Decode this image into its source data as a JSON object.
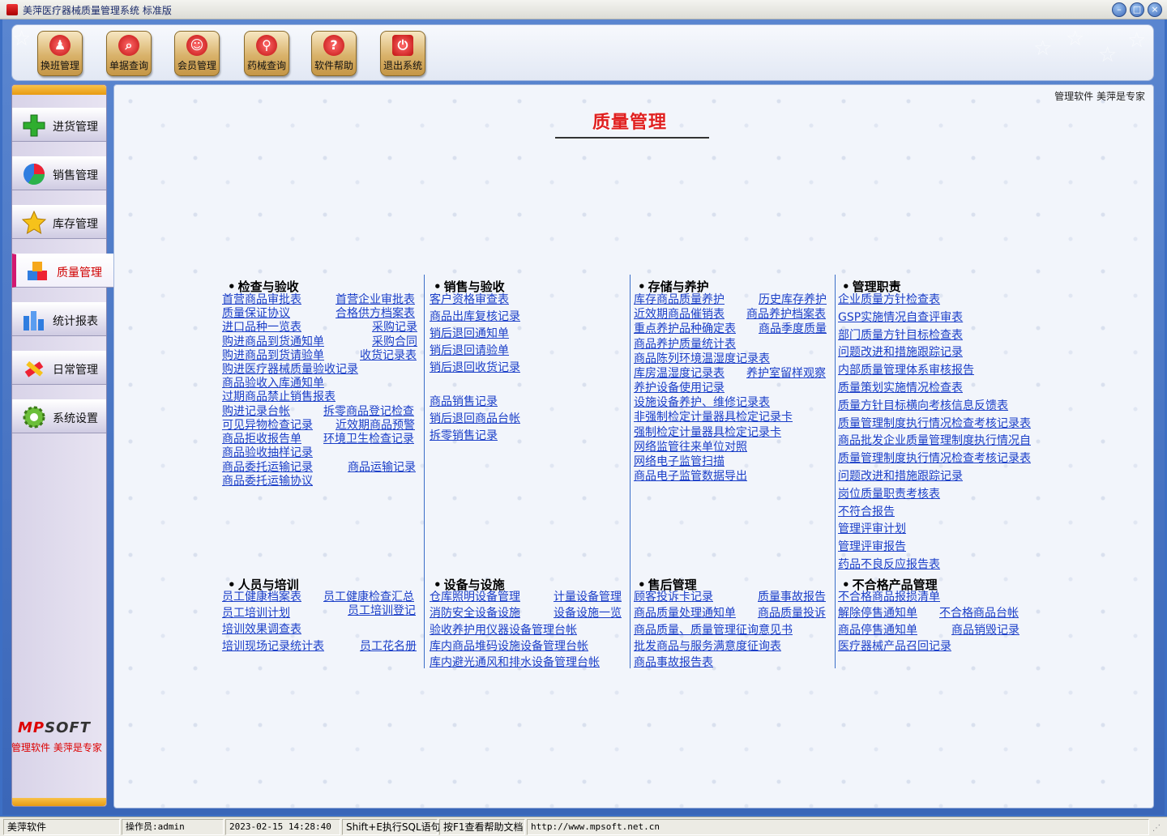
{
  "window": {
    "title": "美萍医疗器械质量管理系统 标准版",
    "minimize": "–",
    "maximize": "□",
    "close": "×"
  },
  "toolbar": [
    {
      "label": "换班管理",
      "icon": "users-icon"
    },
    {
      "label": "单据查询",
      "icon": "search-document-icon"
    },
    {
      "label": "会员管理",
      "icon": "member-icon"
    },
    {
      "label": "药械查询",
      "icon": "search-icon"
    },
    {
      "label": "软件帮助",
      "icon": "help-icon"
    },
    {
      "label": "退出系统",
      "icon": "power-icon"
    }
  ],
  "sidebar": {
    "items": [
      {
        "label": "进货管理",
        "icon": "plus-icon"
      },
      {
        "label": "销售管理",
        "icon": "pie-icon"
      },
      {
        "label": "库存管理",
        "icon": "star-icon"
      },
      {
        "label": "质量管理",
        "icon": "cubes-icon",
        "active": true
      },
      {
        "label": "统计报表",
        "icon": "bar-chart-icon"
      },
      {
        "label": "日常管理",
        "icon": "tools-icon"
      },
      {
        "label": "系统设置",
        "icon": "gear-icon"
      }
    ],
    "logo_brand": "MP",
    "logo_rest": "SOFT",
    "slogan": "管理软件 美萍是专家"
  },
  "main": {
    "corner_text": "管理软件  美萍是专家",
    "title": "质量管理",
    "sections": {
      "inspect": {
        "head": "检查与验收",
        "links": [
          "首营商品审批表",
          "首营企业审批表",
          "质量保证协议",
          "合格供方档案表",
          "进口品种一览表",
          "采购记录",
          "购进商品到货通知单",
          "采购合同",
          "购进商品到货请验单",
          "收货记录表",
          "购进医疗器械质量验收记录",
          "商品验收入库通知单",
          "过期商品禁止销售报表",
          "购进记录台帐",
          "拆零商品登记检查",
          "可见异物检查记录",
          "近效期商品预警",
          "商品拒收报告单",
          "环境卫生检查记录",
          "商品验收抽样记录",
          "商品委托运输记录",
          "商品运输记录",
          "商品委托运输协议"
        ]
      },
      "sales": {
        "head": "销售与验收",
        "links": [
          "客户资格审查表",
          "商品出库复核记录",
          "销后退回通知单",
          "销后退回请验单",
          "销后退回收货记录",
          "商品销售记录",
          "销后退回商品台帐",
          "拆零销售记录"
        ]
      },
      "storage": {
        "head": "存储与养护",
        "links": [
          "库存商品质量养护",
          "历史库存养护",
          "近效期商品催销表",
          "商品养护档案表",
          "重点养护品种确定表",
          "商品季度质量",
          "商品养护质量统计表",
          "商品陈列环境温湿度记录表",
          "库房温湿度记录表",
          "养护室留样观察",
          "养护设备使用记录",
          "设施设备养护、维修记录表",
          "非强制检定计量器具检定记录卡",
          "强制检定计量器具检定记录卡",
          "网络监管往来单位对照",
          "网络电子监管扫描",
          "商品电子监管数据导出"
        ]
      },
      "mgmt": {
        "head": "管理职责",
        "links": [
          "企业质量方针检查表",
          "GSP实施情况自查评审表",
          "部门质量方针目标检查表",
          "问题改进和措施跟踪记录",
          "内部质量管理体系审核报告",
          "质量策划实施情况检查表",
          "质量方针目标横向考核信息反馈表",
          "质量管理制度执行情况检查考核记录表",
          "商品批发企业质量管理制度执行情况自",
          "质量管理制度执行情况检查考核记录表",
          "问题改进和措施跟踪记录",
          "岗位质量职责考核表",
          "不符合报告",
          "管理评审计划",
          "管理评审报告",
          "药品不良反应报告表"
        ]
      },
      "staff": {
        "head": "人员与培训",
        "links": [
          "员工健康档案表",
          "员工健康检查汇总",
          "员工培训计划",
          "员工培训登记",
          "培训效果调查表",
          "培训现场记录统计表",
          "员工花名册"
        ]
      },
      "equip": {
        "head": "设备与设施",
        "links": [
          "仓库照明设备管理",
          "计量设备管理",
          "消防安全设备设施",
          "设备设施一览",
          "验收养护用仪器设备管理台帐",
          "库内商品堆码设施设备管理台帐",
          "库内避光通风和排水设备管理台帐"
        ]
      },
      "after": {
        "head": "售后管理",
        "links": [
          "顾客投诉卡记录",
          "质量事故报告",
          "商品质量处理通知单",
          "商品质量投诉",
          "商品质量、质量管理征询意见书",
          "批发商品与服务满意度征询表",
          "商品事故报告表"
        ]
      },
      "unq": {
        "head": "不合格产品管理",
        "links": [
          "不合格商品报损清单",
          "解除停售通知单",
          "不合格商品台帐",
          "商品停售通知单",
          "商品销毁记录",
          "医疗器械产品召回记录"
        ]
      }
    }
  },
  "status": {
    "company": "美萍软件",
    "operator": "操作员:admin",
    "datetime": "2023-02-15 14:28:40",
    "sql_hint": "Shift+E执行SQL语句",
    "help_hint": "按F1查看帮助文档",
    "url": "http://www.mpsoft.net.cn"
  }
}
